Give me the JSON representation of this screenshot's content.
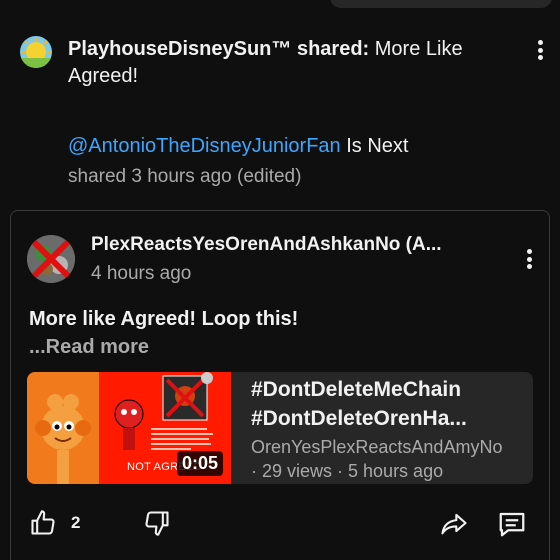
{
  "shared_post": {
    "author": "PlayhouseDisneySun™",
    "action": " shared: ",
    "message_line1": "More Like Agreed!",
    "mention": "@AntonioTheDisneyJuniorFan",
    "mention_suffix": " Is Next",
    "meta": "shared 3 hours ago (edited)"
  },
  "original_post": {
    "author": "PlexReactsYesOrenAndAshkanNo (A...",
    "time": "4 hours ago",
    "body": "More like Agreed! Loop this!",
    "read_more": "...Read more",
    "video": {
      "title_line1": "#DontDeleteMeChain",
      "title_line2": "#DontDeleteOrenHa...",
      "channel": "OrenYesPlexReactsAndAmyNo",
      "stats": "· 29 views · 5 hours ago",
      "duration": "0:05",
      "thumb_caption": "NOT AGREED"
    },
    "likes": "2"
  },
  "icons": {
    "like": "thumbs-up-icon",
    "dislike": "thumbs-down-icon",
    "share": "share-arrow-icon",
    "comments": "comment-icon",
    "more": "more-vertical-icon"
  },
  "colors": {
    "background": "#0f0f0f",
    "mention": "#3ea6ff",
    "secondary_text": "#aaaaaa",
    "thumb_red": "#ff1a00",
    "thumb_orange": "#f07a1c"
  }
}
